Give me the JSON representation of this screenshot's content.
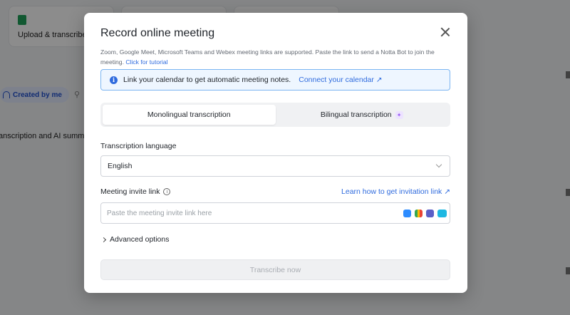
{
  "background": {
    "upload_label": "Upload & transcribe",
    "filter_chip": "Created by me",
    "list_text": "anscription and AI summa"
  },
  "modal": {
    "title": "Record online meeting",
    "description": "Zoom, Google Meet, Microsoft Teams and Webex meeting links are supported. Paste the link to send a Notta Bot to join the meeting.",
    "tutorial_link": "Click for tutorial",
    "banner": {
      "text": "Link your calendar to get automatic meeting notes.",
      "link": "Connect your calendar ↗"
    },
    "modes": {
      "monolingual": "Monolingual transcription",
      "bilingual": "Bilingual transcription",
      "selected": "monolingual"
    },
    "language": {
      "label": "Transcription language",
      "value": "English"
    },
    "invite": {
      "label": "Meeting invite link",
      "learn_link": "Learn how to get invitation link ↗",
      "placeholder": "Paste the meeting invite link here",
      "value": "",
      "app_icons": [
        "zoom-icon",
        "google-meet-icon",
        "teams-icon",
        "webex-icon"
      ]
    },
    "advanced": "Advanced options",
    "submit": "Transcribe now"
  },
  "colors": {
    "accent": "#2f6bde",
    "banner_bg": "#eef6ff",
    "banner_border": "#7bb5f2",
    "disabled_text": "#a9adb3"
  }
}
